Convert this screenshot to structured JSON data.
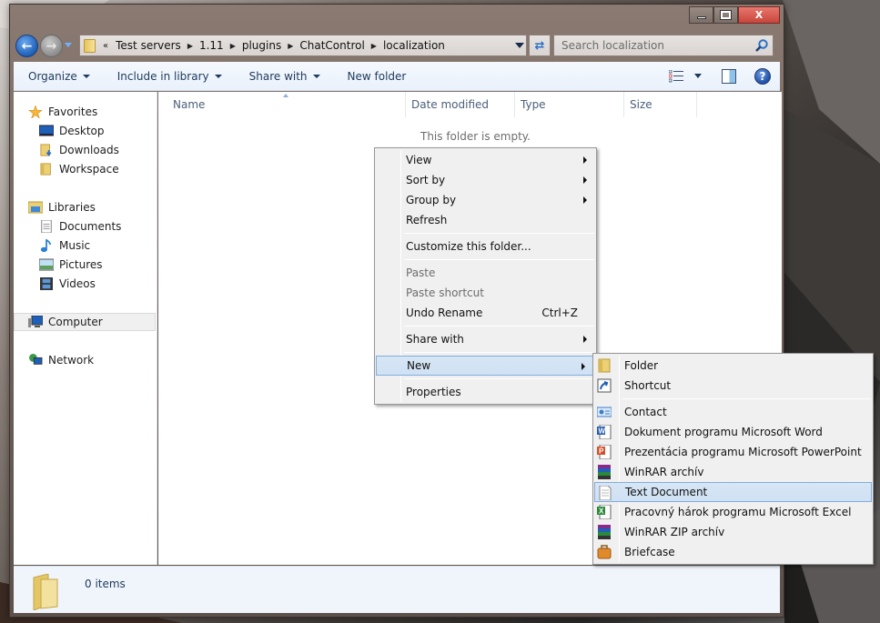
{
  "window": {
    "caption_buttons": {
      "minimize": "minimize",
      "maximize": "maximize",
      "close": "X"
    }
  },
  "navigation": {
    "back_icon": "back-arrow-icon",
    "forward_icon": "forward-arrow-icon",
    "breadcrumb": {
      "overflow": "«",
      "segments": [
        "Test servers",
        "1.11",
        "plugins",
        "ChatControl",
        "localization"
      ]
    },
    "refresh_icon": "refresh-arrows-icon",
    "search_placeholder": "Search localization"
  },
  "toolbar": {
    "organize": "Organize",
    "include_in_library": "Include in library",
    "share_with": "Share with",
    "new_folder": "New folder",
    "help": "?"
  },
  "sidebar": {
    "favorites": {
      "label": "Favorites",
      "items": [
        "Desktop",
        "Downloads",
        "Workspace"
      ]
    },
    "libraries": {
      "label": "Libraries",
      "items": [
        "Documents",
        "Music",
        "Pictures",
        "Videos"
      ]
    },
    "computer": "Computer",
    "network": "Network"
  },
  "content": {
    "columns": [
      "Name",
      "Date modified",
      "Type",
      "Size"
    ],
    "sorted_column": "Name",
    "empty_message": "This folder is empty."
  },
  "status": {
    "item_count": "0 items"
  },
  "context_menu": {
    "items": [
      {
        "label": "View",
        "submenu": true
      },
      {
        "label": "Sort by",
        "submenu": true
      },
      {
        "label": "Group by",
        "submenu": true
      },
      {
        "label": "Refresh"
      },
      {
        "label": "Customize this folder..."
      },
      {
        "label": "Paste",
        "disabled": true
      },
      {
        "label": "Paste shortcut",
        "disabled": true
      },
      {
        "label": "Undo Rename",
        "shortcut": "Ctrl+Z"
      },
      {
        "label": "Share with",
        "submenu": true
      },
      {
        "label": "New",
        "submenu": true,
        "highlighted": true
      },
      {
        "label": "Properties"
      }
    ]
  },
  "new_submenu": {
    "items": [
      {
        "label": "Folder",
        "icon": "folder-icon"
      },
      {
        "label": "Shortcut",
        "icon": "shortcut-icon"
      },
      {
        "label": "Contact",
        "icon": "contact-icon"
      },
      {
        "label": "Dokument programu Microsoft Word",
        "icon": "word-document-icon"
      },
      {
        "label": "Prezentácia programu Microsoft PowerPoint",
        "icon": "powerpoint-icon"
      },
      {
        "label": "WinRAR archív",
        "icon": "winrar-icon"
      },
      {
        "label": "Text Document",
        "icon": "text-document-icon",
        "highlighted": true
      },
      {
        "label": "Pracovný hárok programu Microsoft Excel",
        "icon": "excel-icon"
      },
      {
        "label": "WinRAR ZIP archív",
        "icon": "winrar-zip-icon"
      },
      {
        "label": "Briefcase",
        "icon": "briefcase-icon"
      }
    ]
  },
  "colors": {
    "menu_highlight": "#cfe1f3",
    "menu_highlight_border": "#84acdd",
    "close_button": "#c7453b",
    "toolbar_text": "#1e395b"
  }
}
